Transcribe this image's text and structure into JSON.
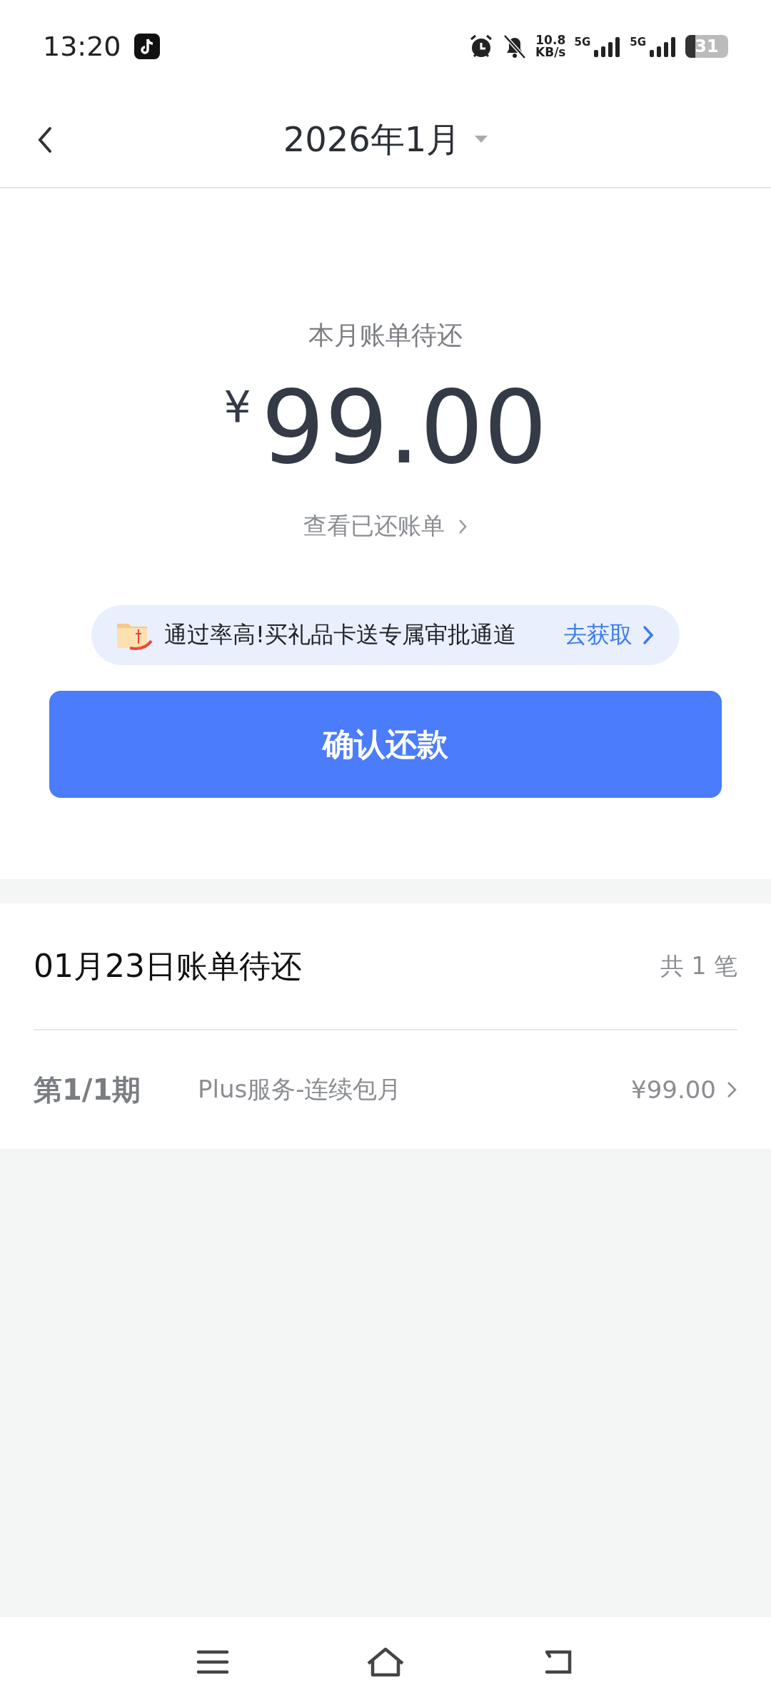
{
  "status_bar": {
    "time": "13:20",
    "net_speed": "10.8",
    "net_unit": "KB/s",
    "sim_1": "5G",
    "sim_2": "5G",
    "battery": "31"
  },
  "header": {
    "title": "2026年1月"
  },
  "summary": {
    "label": "本月账单待还",
    "currency": "¥",
    "amount": "99.00",
    "history_link": "查看已还账单"
  },
  "promo": {
    "text": "通过率高!买礼品卡送专属审批通道",
    "action": "去获取"
  },
  "confirm_button": "确认还款",
  "bill": {
    "title": "01月23日账单待还",
    "count": "共 1 笔",
    "items": [
      {
        "period": "第1/1期",
        "name": "Plus服务-连续包月",
        "amount": "¥99.00"
      }
    ]
  }
}
